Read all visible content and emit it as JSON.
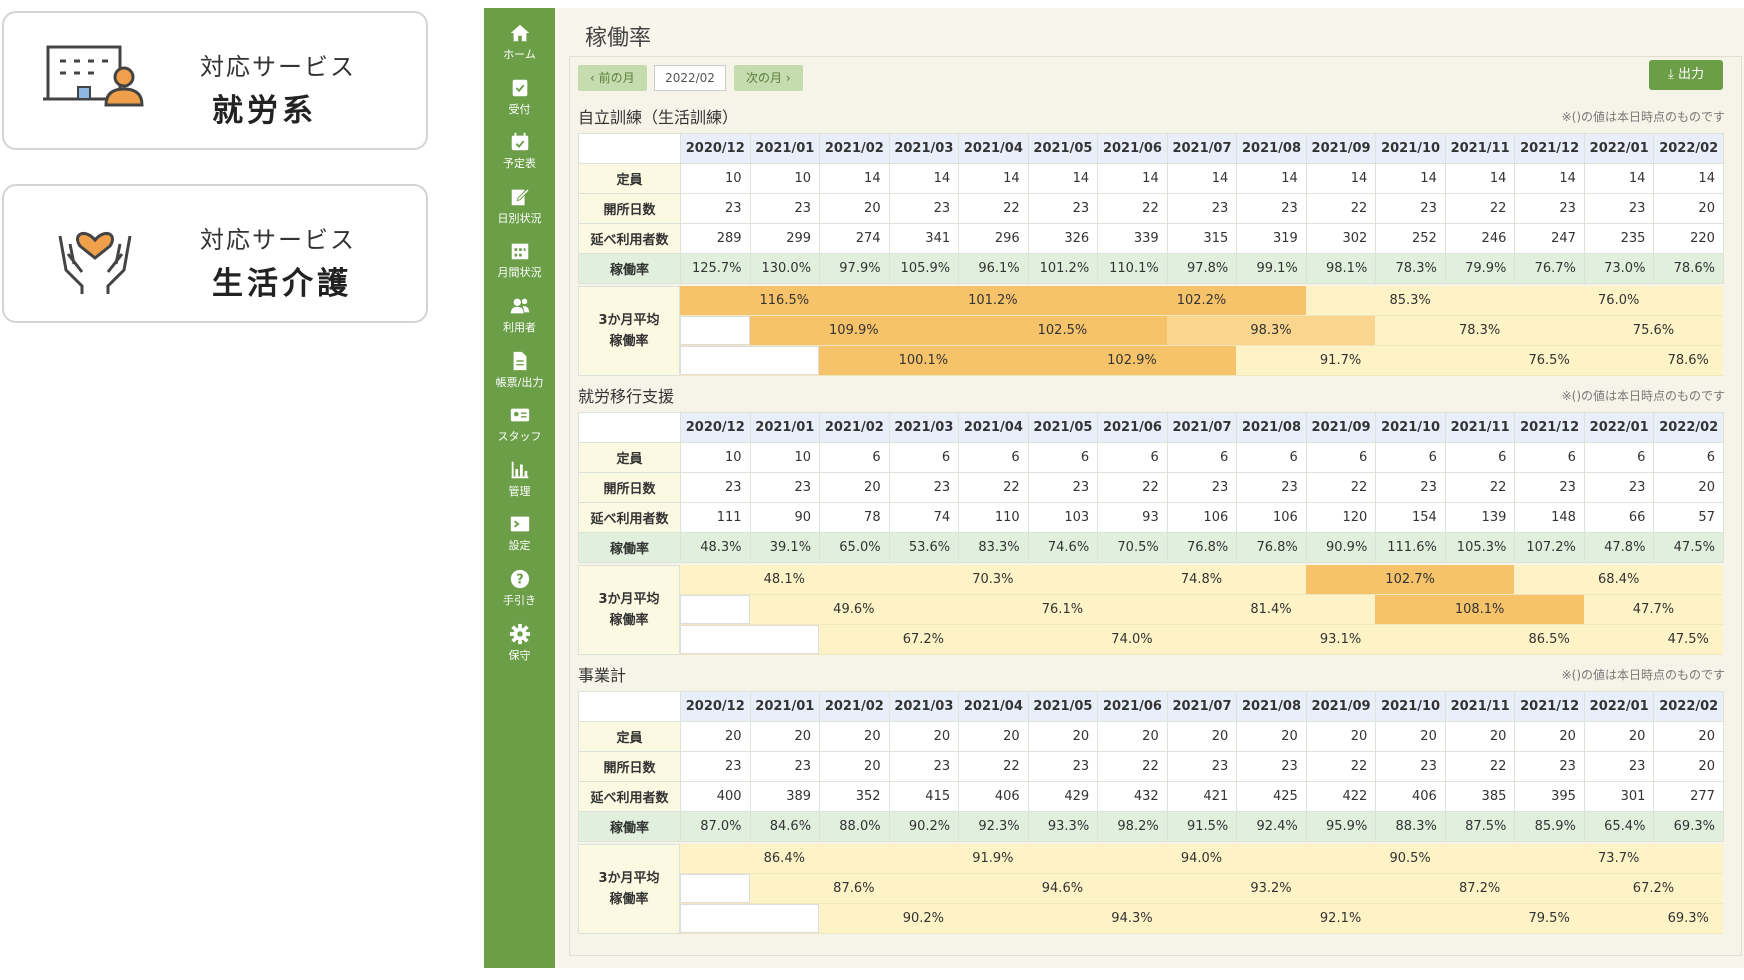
{
  "cards": [
    {
      "line1": "対応サービス",
      "line2": "就労系",
      "icon": "office-worker-icon"
    },
    {
      "line1": "対応サービス",
      "line2": "生活介護",
      "icon": "caring-hands-heart-icon"
    }
  ],
  "sidebar": {
    "items": [
      {
        "label": "ホーム",
        "icon": "home-icon"
      },
      {
        "label": "受付",
        "icon": "reception-icon"
      },
      {
        "label": "予定表",
        "icon": "calendar-check-icon"
      },
      {
        "label": "日別状況",
        "icon": "edit-icon"
      },
      {
        "label": "月間状況",
        "icon": "calendar-grid-icon"
      },
      {
        "label": "利用者",
        "icon": "users-icon"
      },
      {
        "label": "帳票/出力",
        "icon": "document-icon"
      },
      {
        "label": "スタッフ",
        "icon": "id-card-icon"
      },
      {
        "label": "管理",
        "icon": "bar-chart-icon"
      },
      {
        "label": "設定",
        "icon": "terminal-icon"
      },
      {
        "label": "手引き",
        "icon": "help-icon"
      },
      {
        "label": "保守",
        "icon": "gear-icon"
      }
    ],
    "bg_color": "#6b9e47"
  },
  "page": {
    "title": "稼働率",
    "prev_month": "前の月",
    "next_month": "次の月",
    "current_month": "2022/02",
    "export": "出力",
    "note": "※()の値は本日時点のものです"
  },
  "months": [
    "2020/12",
    "2021/01",
    "2021/02",
    "2021/03",
    "2021/04",
    "2021/05",
    "2021/06",
    "2021/07",
    "2021/08",
    "2021/09",
    "2021/10",
    "2021/11",
    "2021/12",
    "2022/01",
    "2022/02"
  ],
  "row_labels": {
    "capacity": "定員",
    "open_days": "開所日数",
    "users": "延べ利用者数",
    "rate": "稼働率",
    "avg_line1": "3か月平均",
    "avg_line2": "稼働率"
  },
  "sections": [
    {
      "title": "自立訓練（生活訓練）",
      "capacity": [
        "10",
        "10",
        "14",
        "14",
        "14",
        "14",
        "14",
        "14",
        "14",
        "14",
        "14",
        "14",
        "14",
        "14",
        "14"
      ],
      "open_days": [
        "23",
        "23",
        "20",
        "23",
        "22",
        "23",
        "22",
        "23",
        "23",
        "22",
        "23",
        "22",
        "23",
        "23",
        "20"
      ],
      "users": [
        "289",
        "299",
        "274",
        "341",
        "296",
        "326",
        "339",
        "315",
        "319",
        "302",
        "252",
        "246",
        "247",
        "235",
        "220"
      ],
      "rate": [
        "125.7%",
        "130.0%",
        "97.9%",
        "105.9%",
        "96.1%",
        "101.2%",
        "110.1%",
        "97.8%",
        "99.1%",
        "98.1%",
        "78.3%",
        "79.9%",
        "76.7%",
        "73.0%",
        "78.6%"
      ],
      "avg": [
        [
          "116.5%",
          "101.2%",
          "102.2%",
          "85.3%",
          "76.0%"
        ],
        [
          "109.9%",
          "102.5%",
          "98.3%",
          "78.3%",
          "75.6%"
        ],
        [
          "100.1%",
          "102.9%",
          "91.7%",
          "76.5%",
          "78.6%"
        ]
      ]
    },
    {
      "title": "就労移行支援",
      "capacity": [
        "10",
        "10",
        "6",
        "6",
        "6",
        "6",
        "6",
        "6",
        "6",
        "6",
        "6",
        "6",
        "6",
        "6",
        "6"
      ],
      "open_days": [
        "23",
        "23",
        "20",
        "23",
        "22",
        "23",
        "22",
        "23",
        "23",
        "22",
        "23",
        "22",
        "23",
        "23",
        "20"
      ],
      "users": [
        "111",
        "90",
        "78",
        "74",
        "110",
        "103",
        "93",
        "106",
        "106",
        "120",
        "154",
        "139",
        "148",
        "66",
        "57"
      ],
      "rate": [
        "48.3%",
        "39.1%",
        "65.0%",
        "53.6%",
        "83.3%",
        "74.6%",
        "70.5%",
        "76.8%",
        "76.8%",
        "90.9%",
        "111.6%",
        "105.3%",
        "107.2%",
        "47.8%",
        "47.5%"
      ],
      "avg": [
        [
          "48.1%",
          "70.3%",
          "74.8%",
          "102.7%",
          "68.4%"
        ],
        [
          "49.6%",
          "76.1%",
          "81.4%",
          "108.1%",
          "47.7%"
        ],
        [
          "67.2%",
          "74.0%",
          "93.1%",
          "86.5%",
          "47.5%"
        ]
      ]
    },
    {
      "title": "事業計",
      "capacity": [
        "20",
        "20",
        "20",
        "20",
        "20",
        "20",
        "20",
        "20",
        "20",
        "20",
        "20",
        "20",
        "20",
        "20",
        "20"
      ],
      "open_days": [
        "23",
        "23",
        "20",
        "23",
        "22",
        "23",
        "22",
        "23",
        "23",
        "22",
        "23",
        "22",
        "23",
        "23",
        "20"
      ],
      "users": [
        "400",
        "389",
        "352",
        "415",
        "406",
        "429",
        "432",
        "421",
        "425",
        "422",
        "406",
        "385",
        "395",
        "301",
        "277"
      ],
      "rate": [
        "87.0%",
        "84.6%",
        "88.0%",
        "90.2%",
        "92.3%",
        "93.3%",
        "98.2%",
        "91.5%",
        "92.4%",
        "95.9%",
        "88.3%",
        "87.5%",
        "85.9%",
        "65.4%",
        "69.3%"
      ],
      "avg": [
        [
          "86.4%",
          "91.9%",
          "94.0%",
          "90.5%",
          "73.7%"
        ],
        [
          "87.6%",
          "94.6%",
          "93.2%",
          "87.2%",
          "67.2%"
        ],
        [
          "90.2%",
          "94.3%",
          "92.1%",
          "79.5%",
          "69.3%"
        ]
      ]
    }
  ]
}
